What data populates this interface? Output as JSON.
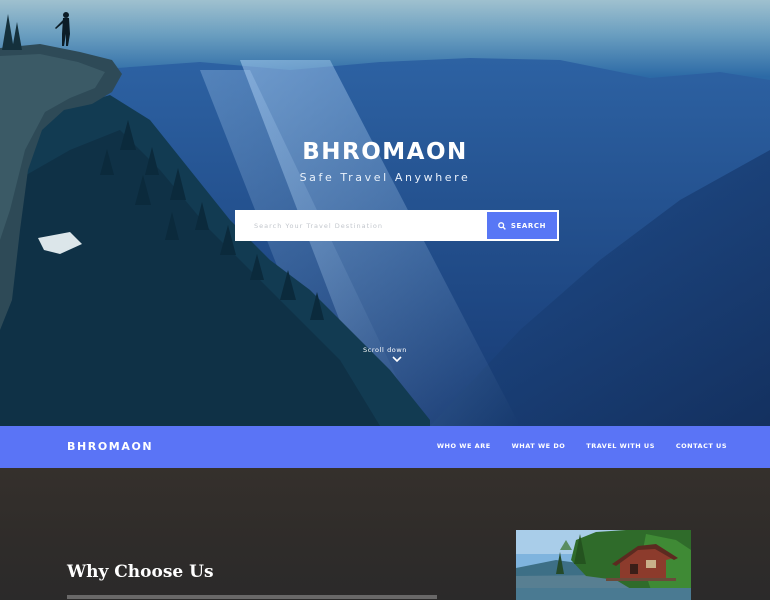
{
  "hero": {
    "title": "BHROMAON",
    "tagline": "Safe Travel Anywhere",
    "search": {
      "placeholder": "Search Your Travel Destination",
      "button_label": "SEARCH",
      "icon": "search-icon"
    },
    "scroll_label": "Scroll down",
    "scroll_icon": "chevron-down-icon"
  },
  "navbar": {
    "logo": "BHROMAON",
    "links": [
      "WHO WE ARE",
      "WHAT WE DO",
      "TRAVEL WITH US",
      "CONTACT US"
    ],
    "background": "#5a74f6"
  },
  "about": {
    "heading": "Why Choose Us"
  },
  "colors": {
    "accent": "#5877f5",
    "hero_sky": "#2c6aa6",
    "section_dark": "#2f2c2a"
  }
}
